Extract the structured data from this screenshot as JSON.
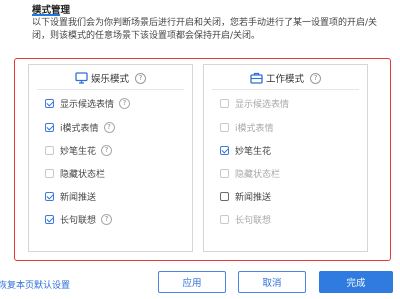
{
  "header": {
    "title": "模式管理",
    "description": "以下设置我们会为你判断场景后进行开启和关闭，您若手动进行了某一设置项的开启/关闭，则该模式的任意场景下该设置项都会保持开启/关闭。"
  },
  "panels": [
    {
      "title": "娱乐模式",
      "icon": "monitor-icon",
      "items": [
        {
          "label": "显示候选表情",
          "checked": true,
          "disabled": false,
          "help": true
        },
        {
          "label": "i模式表情",
          "checked": true,
          "disabled": false,
          "help": true
        },
        {
          "label": "妙笔生花",
          "checked": false,
          "disabled": false,
          "help": true
        },
        {
          "label": "隐藏状态栏",
          "checked": false,
          "disabled": false,
          "help": false
        },
        {
          "label": "新闻推送",
          "checked": true,
          "disabled": false,
          "help": false
        },
        {
          "label": "长句联想",
          "checked": true,
          "disabled": false,
          "help": true
        }
      ]
    },
    {
      "title": "工作模式",
      "icon": "briefcase-icon",
      "items": [
        {
          "label": "显示候选表情",
          "checked": false,
          "disabled": true,
          "help": false
        },
        {
          "label": "i模式表情",
          "checked": false,
          "disabled": true,
          "help": false
        },
        {
          "label": "妙笔生花",
          "checked": true,
          "disabled": false,
          "help": false
        },
        {
          "label": "隐藏状态栏",
          "checked": false,
          "disabled": true,
          "help": false
        },
        {
          "label": "新闻推送",
          "checked": false,
          "disabled": false,
          "help": false
        },
        {
          "label": "长句联想",
          "checked": false,
          "disabled": true,
          "help": false
        }
      ]
    }
  ],
  "footer": {
    "restore_label": "恢复本页默认设置",
    "apply_label": "应用",
    "cancel_label": "取消",
    "done_label": "完成"
  },
  "colors": {
    "accent": "#2f7be0",
    "highlight_border": "#e53935",
    "disabled_text": "#a8a8a8"
  }
}
